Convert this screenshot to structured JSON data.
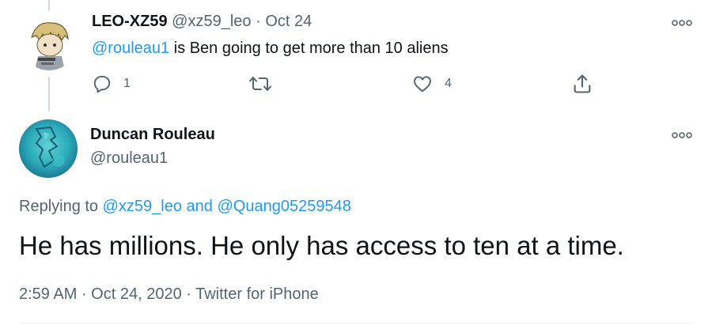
{
  "tweet1": {
    "display_name": "LEO-XZ59",
    "handle": "@xz59_leo",
    "separator": "·",
    "date": "Oct 24",
    "mention": "@rouleau1",
    "text": " is Ben going to get more than 10 aliens",
    "replies_count": "1",
    "retweets_count": "",
    "likes_count": "4"
  },
  "tweet2": {
    "display_name": "Duncan Rouleau",
    "handle": "@rouleau1",
    "replying_prefix": "Replying to ",
    "reply_to_1": "@xz59_leo",
    "reply_and": " and ",
    "reply_to_2": "@Quang05259548",
    "text": "He has millions. He only has access to ten at a time.",
    "time": "2:59 AM",
    "dot1": " · ",
    "date": "Oct 24, 2020",
    "dot2": " · ",
    "source": "Twitter for iPhone"
  },
  "colors": {
    "accent": "#1d9bf0",
    "muted": "#536471",
    "text": "#0f1419"
  },
  "icons": [
    "reply-icon",
    "retweet-icon",
    "like-icon",
    "share-icon",
    "more-icon"
  ]
}
